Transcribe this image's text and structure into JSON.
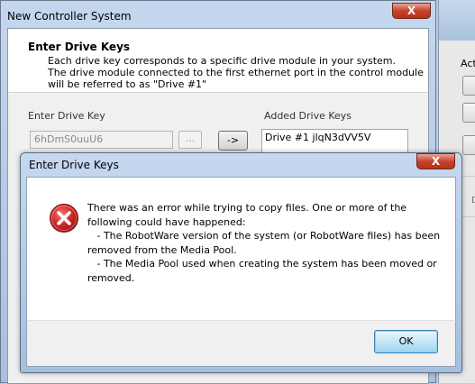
{
  "main_window": {
    "title": "New Controller System",
    "close_glyph": "X",
    "header": {
      "title": "Enter Drive Keys",
      "description_lines": [
        "Each drive key corresponds to a specific drive module in your system.",
        "The drive module connected to the first ethernet port in the control module",
        "will be referred to as \"Drive #1\""
      ]
    },
    "enter_key_label": "Enter Drive Key",
    "key_input_value": "6hDmS0uuU6",
    "browse_label": "...",
    "add_label": "->",
    "added_keys_label": "Added Drive Keys",
    "added_keys": [
      "Drive #1  jlqN3dVV5V"
    ]
  },
  "background_window": {
    "partial_label": "Acti",
    "partial_letter": "D"
  },
  "dialog": {
    "title": "Enter Drive Keys",
    "close_glyph": "X",
    "icon": "error-icon",
    "message_lines": [
      "There was an error while trying to copy files. One or more of the",
      "following could have happened:",
      "   - The RobotWare version of the system (or RobotWare files) has been",
      "removed from the Media Pool.",
      "   - The Media Pool used when creating the system has been moved or",
      "removed."
    ],
    "ok_label": "OK"
  },
  "colors": {
    "desktop": "#b9cde4",
    "error_red": "#d42a2a",
    "close_button": "#c8422c",
    "ok_border": "#3c7fb1"
  }
}
